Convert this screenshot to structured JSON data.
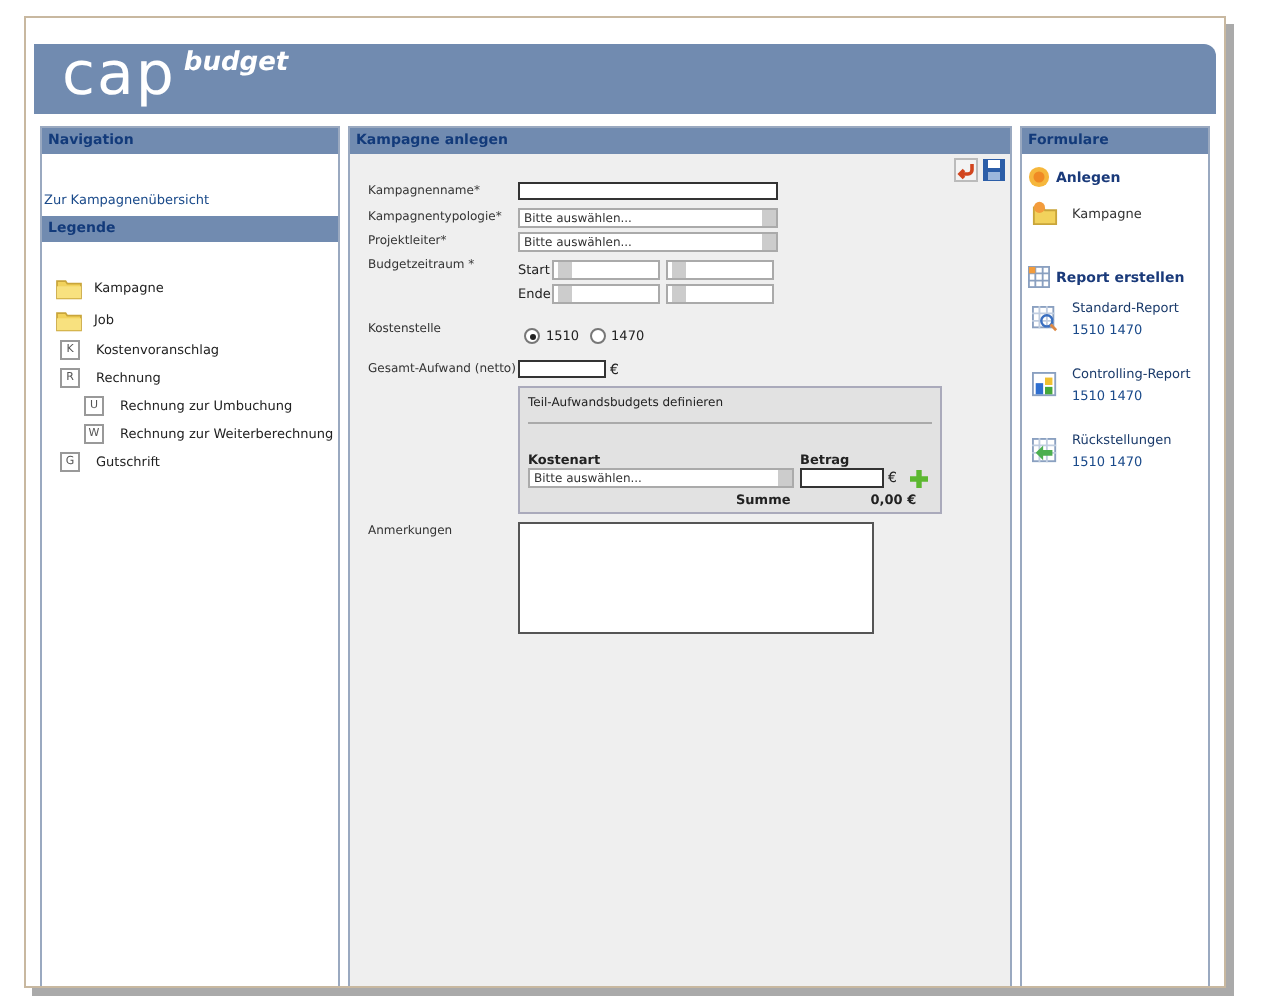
{
  "header": {
    "logo": "cap",
    "logo_sup": "budget"
  },
  "navigation": {
    "title": "Navigation",
    "link": "Zur Kampagnenübersicht"
  },
  "legend": {
    "title": "Legende",
    "items": [
      {
        "label": "Kampagne",
        "kind": "folder"
      },
      {
        "label": "Job",
        "kind": "folder"
      },
      {
        "label": "Kostenvoranschlag",
        "kind": "doc",
        "letter": "K"
      },
      {
        "label": "Rechnung",
        "kind": "doc",
        "letter": "R",
        "children": [
          {
            "label": "Rechnung zur Umbuchung",
            "kind": "doc",
            "letter": "U"
          },
          {
            "label": "Rechnung zur Weiterberechnung",
            "kind": "doc",
            "letter": "W"
          }
        ]
      },
      {
        "label": "Gutschrift",
        "kind": "doc",
        "letter": "G"
      }
    ]
  },
  "form": {
    "title": "Kampagne anlegen",
    "fields": [
      {
        "label": "Kampagnenname*",
        "kind": "text"
      },
      {
        "label": "Kampagnentypologie*",
        "kind": "select",
        "placeholder": "Bitte auswählen..."
      },
      {
        "label": "Projektleiter*",
        "kind": "select",
        "placeholder": "Bitte auswählen..."
      },
      {
        "label": "Budgetzeitraum *",
        "kind": "dates",
        "rows": [
          "Start",
          "Ende"
        ]
      },
      {
        "label": "Kostenstelle",
        "kind": "radio",
        "options": [
          {
            "label": "1510",
            "selected": true
          },
          {
            "label": "1470",
            "selected": false
          }
        ]
      },
      {
        "label": "Gesamt-Aufwand (netto)",
        "kind": "amount",
        "unit": "€"
      }
    ],
    "sub": {
      "title": "Teil-Aufwandsbudgets definieren",
      "cost_label": "Kostenart",
      "cost_placeholder": "Bitte auswählen...",
      "amount_label": "Betrag",
      "unit": "€",
      "sum_label": "Summe",
      "sum": "0,00 €"
    },
    "notes_label": "Anmerkungen"
  },
  "forms_panel": {
    "title": "Formulare",
    "sections": [
      {
        "heading": "Anlegen",
        "kind": "create",
        "items": [
          {
            "label": "Kampagne",
            "kind": "folder"
          }
        ]
      },
      {
        "heading": "Report erstellen",
        "kind": "report",
        "items": [
          {
            "label": "Standard-Report",
            "sub": "1510 1470",
            "kind": "standard"
          },
          {
            "label": "Controlling-Report",
            "sub": "1510 1470",
            "kind": "controlling"
          },
          {
            "label": "Rückstellungen",
            "sub": "1510 1470",
            "kind": "provision"
          }
        ]
      }
    ]
  }
}
